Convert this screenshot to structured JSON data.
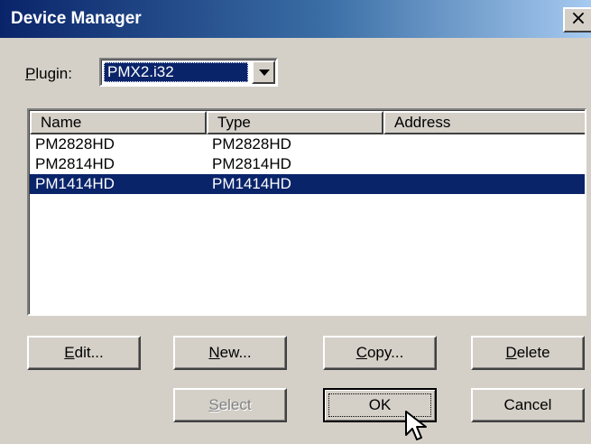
{
  "window": {
    "title": "Device Manager",
    "close_label": "×"
  },
  "plugin": {
    "label_first": "P",
    "label_rest": "lugin:",
    "value": "PMX2.i32"
  },
  "list": {
    "columns": [
      "Name",
      "Type",
      "Address"
    ],
    "rows": [
      {
        "name": "PM2828HD",
        "type": "PM2828HD",
        "address": "",
        "selected": false
      },
      {
        "name": "PM2814HD",
        "type": "PM2814HD",
        "address": "",
        "selected": false
      },
      {
        "name": "PM1414HD",
        "type": "PM1414HD",
        "address": "",
        "selected": true
      }
    ]
  },
  "buttons": {
    "edit": {
      "mnemonic": "E",
      "rest": "dit..."
    },
    "new": {
      "mnemonic": "N",
      "rest": "ew..."
    },
    "copy": {
      "mnemonic": "C",
      "rest": "opy..."
    },
    "delete": {
      "mnemonic": "D",
      "rest": "elete"
    },
    "select": {
      "mnemonic": "S",
      "rest": "elect",
      "enabled": false
    },
    "ok": {
      "label": "OK"
    },
    "cancel": {
      "label": "Cancel"
    }
  },
  "colors": {
    "selection": "#0a246a",
    "face": "#d4d0c8"
  }
}
